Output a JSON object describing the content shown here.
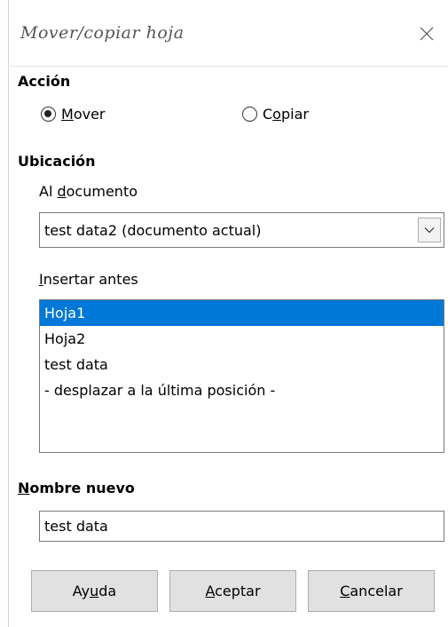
{
  "dialog": {
    "title": "Mover/copiar hoja"
  },
  "action": {
    "heading": "Acción",
    "options": [
      {
        "pre": "",
        "acc": "M",
        "post": "over",
        "checked": true
      },
      {
        "pre": "C",
        "acc": "o",
        "post": "piar",
        "checked": false
      }
    ]
  },
  "location": {
    "heading": "Ubicación",
    "document_label": {
      "pre": "Al ",
      "acc": "d",
      "post": "ocumento"
    },
    "document_value": "test data2 (documento actual)",
    "insert_label": {
      "pre": "",
      "acc": "I",
      "post": "nsertar antes"
    },
    "sheets": [
      {
        "label": "Hoja1",
        "selected": true
      },
      {
        "label": "Hoja2",
        "selected": false
      },
      {
        "label": "test data",
        "selected": false
      },
      {
        "label": "- desplazar a la última posición -",
        "selected": false
      }
    ]
  },
  "new_name": {
    "label": {
      "pre": "",
      "acc": "N",
      "post": "ombre nuevo"
    },
    "value": "test data"
  },
  "buttons": {
    "help": {
      "pre": "Ay",
      "acc": "u",
      "post": "da"
    },
    "ok": {
      "pre": "",
      "acc": "A",
      "post": "ceptar"
    },
    "cancel": {
      "pre": "",
      "acc": "C",
      "post": "ancelar"
    }
  },
  "colors": {
    "selection": "#0078d7",
    "button_face": "#e1e1e1",
    "title_text": "#555555"
  }
}
